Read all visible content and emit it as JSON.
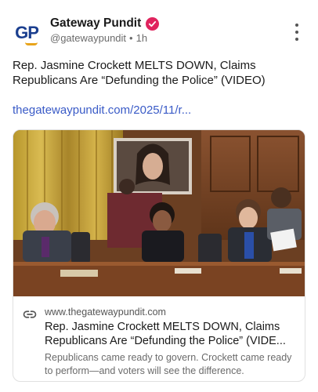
{
  "author": {
    "avatar_text": "GP",
    "display_name": "Gateway Pundit",
    "handle": "@gatewaypundit",
    "separator": "•",
    "time": "1h",
    "verified": true
  },
  "post": {
    "text": "Rep. Jasmine Crockett MELTS DOWN, Claims Republicans Are “Defunding the Police” (VIDEO)",
    "link_text": "thegatewaypundit.com/2025/11/r..."
  },
  "link_card": {
    "domain": "www.thegatewaypundit.com",
    "title_line1": "Rep. Jasmine Crockett MELTS DOWN, Claims",
    "title_line2": "Republicans Are “Defunding the Police” (VIDE...",
    "description": "Republicans came ready to govern. Crockett came ready to perform—and voters will see the difference."
  },
  "colors": {
    "link": "#3a5bc7",
    "verified_badge": "#e0245e",
    "brand_blue": "#1b3f8f",
    "brand_gold": "#e8a41b"
  }
}
